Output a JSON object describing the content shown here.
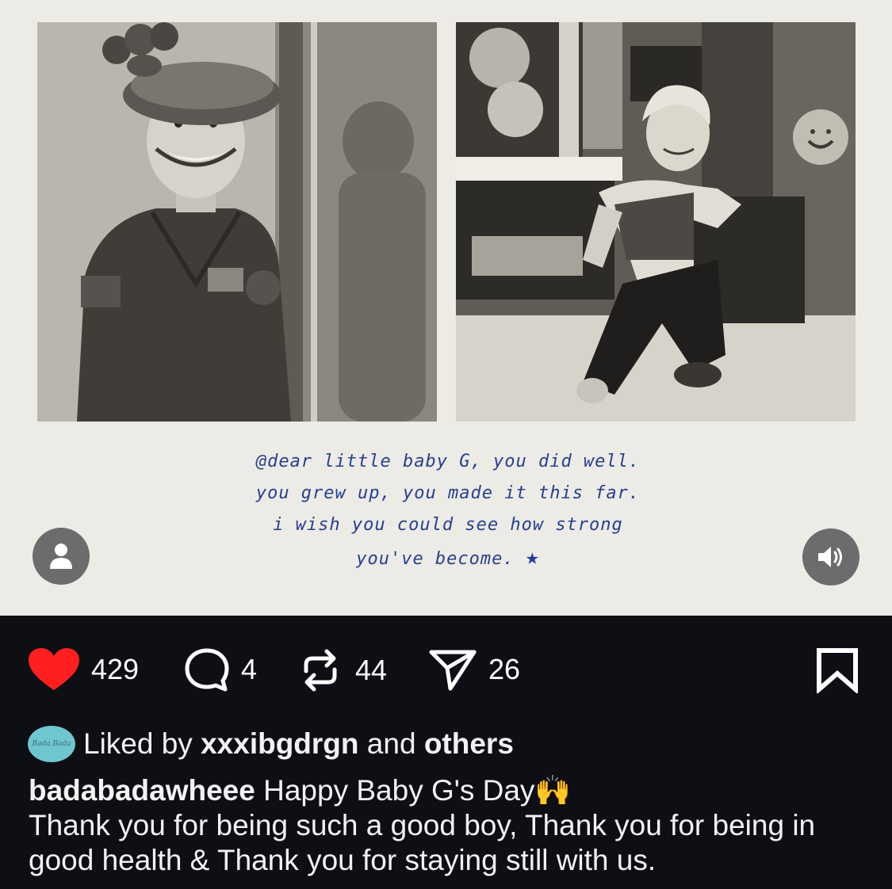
{
  "post": {
    "handwritten_note": [
      "@dear little baby G, you did well.",
      "you grew up, you made it this far.",
      "i wish you could see how strong",
      "you've become."
    ],
    "note_star": "★"
  },
  "actions": {
    "likes": "429",
    "comments": "4",
    "reposts": "44",
    "shares": "26"
  },
  "liked_by": {
    "prefix": "Liked by",
    "user": "xxxibgdrgn",
    "connector": "and",
    "others": "others",
    "avatar_text": "Bada Bada"
  },
  "caption": {
    "username": "badabadawheee",
    "text_line1": "Happy Baby G's Day🙌",
    "text_rest": "Thank you for being such a good boy, Thank you for being in good health & Thank you for staying still with us."
  },
  "colors": {
    "like": "#ff1f1f",
    "background": "#0d0f14",
    "image_bg": "#ecebe6",
    "handwriting": "#27408f"
  },
  "icons": [
    "heart-icon",
    "comment-icon",
    "repost-icon",
    "share-icon",
    "bookmark-icon",
    "user-tag-icon",
    "speaker-icon"
  ]
}
